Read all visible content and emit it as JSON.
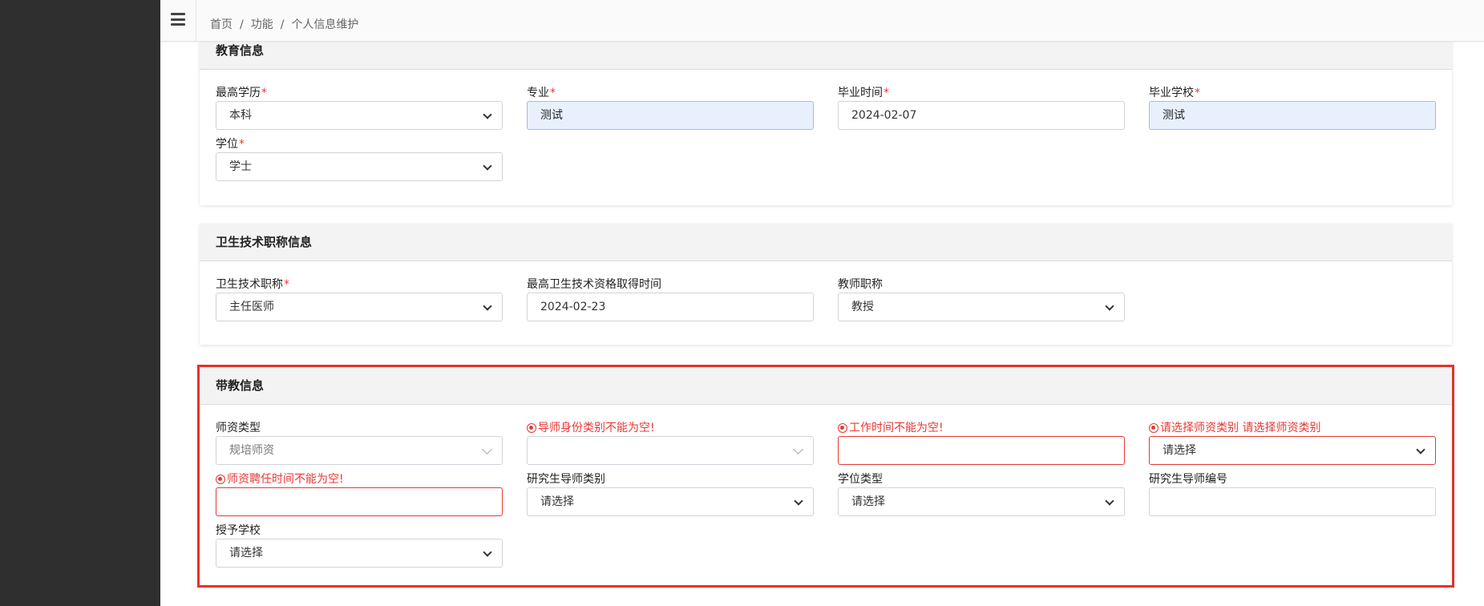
{
  "breadcrumb": [
    "首页",
    "功能",
    "个人信息维护"
  ],
  "sections": {
    "education": {
      "title": "教育信息",
      "fields": {
        "highest_degree": {
          "label": "最高学历",
          "value": "本科"
        },
        "major": {
          "label": "专业",
          "value": "测试"
        },
        "graduation_time": {
          "label": "毕业时间",
          "value": "2024-02-07"
        },
        "graduation_school": {
          "label": "毕业学校",
          "value": "测试"
        },
        "academic_degree": {
          "label": "学位",
          "value": "学士"
        }
      }
    },
    "title_info": {
      "title": "卫生技术职称信息",
      "fields": {
        "health_title": {
          "label": "卫生技术职称",
          "value": "主任医师"
        },
        "qualification_time": {
          "label": "最高卫生技术资格取得时间",
          "value": "2024-02-23"
        },
        "teacher_title": {
          "label": "教师职称",
          "value": "教授"
        }
      }
    },
    "teaching": {
      "title": "带教信息",
      "fields": {
        "faculty_type": {
          "label": "师资类型",
          "value": "规培师资"
        },
        "mentor_category": {
          "error": "导师身份类别不能为空!",
          "value": ""
        },
        "work_time": {
          "error": "工作时间不能为空!",
          "value": ""
        },
        "faculty_category": {
          "error": "请选择师资类别 请选择师资类别",
          "value": "请选择"
        },
        "appointment_time": {
          "error": "师资聘任时间不能为空!",
          "value": ""
        },
        "grad_mentor_type": {
          "label": "研究生导师类别",
          "value": "请选择"
        },
        "degree_type": {
          "label": "学位类型",
          "value": "请选择"
        },
        "grad_mentor_number": {
          "label": "研究生导师编号",
          "value": ""
        },
        "awarding_school": {
          "label": "授予学校",
          "value": "请选择"
        }
      }
    }
  },
  "required_mark": "*"
}
